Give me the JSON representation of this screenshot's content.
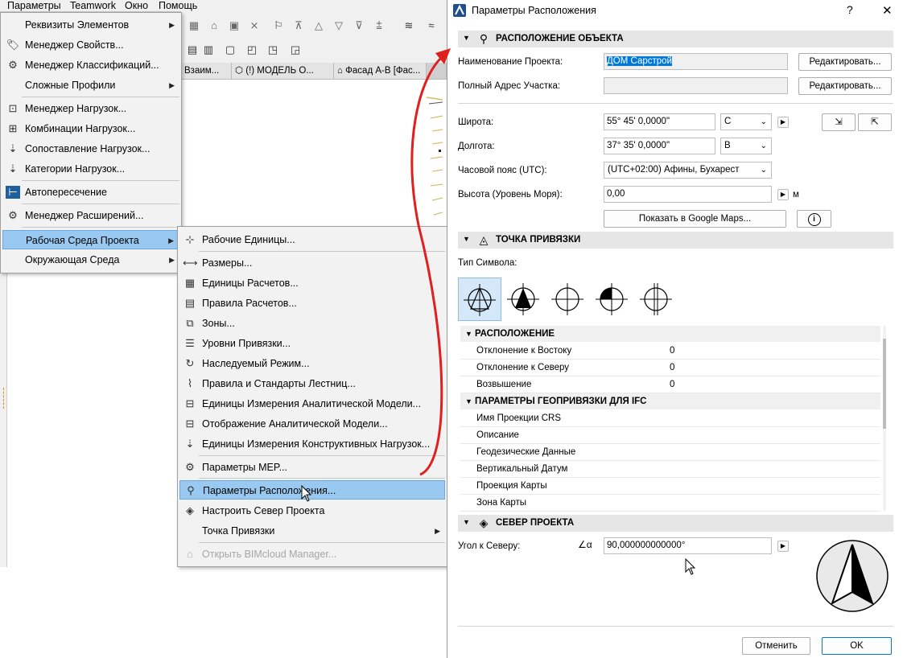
{
  "menubar": [
    "Параметры",
    "Teamwork",
    "Окно",
    "Помощь"
  ],
  "tabs": [
    "Взаим...",
    "(!) МОДЕЛЬ О...",
    "Фасад А-В [Фас...",
    ""
  ],
  "params_menu": {
    "items": [
      {
        "label": "Реквизиты Элементов",
        "icon": "attributes-icon",
        "submenu": true
      },
      {
        "label": "Менеджер Свойств...",
        "icon": "properties-manager-icon"
      },
      {
        "label": "Менеджер Классификаций...",
        "icon": "classification-manager-icon"
      },
      {
        "label": "Сложные Профили",
        "icon": "complex-profiles-icon",
        "submenu": true
      },
      {
        "label": "Менеджер Нагрузок...",
        "icon": "load-manager-icon"
      },
      {
        "label": "Комбинации Нагрузок...",
        "icon": "load-combinations-icon"
      },
      {
        "label": "Сопоставление Нагрузок...",
        "icon": "load-mapping-icon"
      },
      {
        "label": "Категории Нагрузок...",
        "icon": "load-categories-icon"
      },
      {
        "label": "Автопересечение",
        "icon": "auto-intersection-icon"
      },
      {
        "label": "Менеджер Расширений...",
        "icon": "add-on-manager-icon"
      },
      {
        "label": "Рабочая Среда Проекта",
        "icon": "",
        "submenu": true
      },
      {
        "label": "Окружающая Среда",
        "icon": "",
        "submenu": true
      }
    ]
  },
  "project_pref_menu": {
    "items": [
      {
        "label": "Рабочие Единицы...",
        "icon": "working-units-icon"
      },
      {
        "label": "Размеры...",
        "icon": "dimensions-icon"
      },
      {
        "label": "Единицы Расчетов...",
        "icon": "calculation-units-icon"
      },
      {
        "label": "Правила Расчетов...",
        "icon": "calculation-rules-icon"
      },
      {
        "label": "Зоны...",
        "icon": "zones-icon"
      },
      {
        "label": "Уровни Привязки...",
        "icon": "reference-levels-icon"
      },
      {
        "label": "Наследуемый Режим...",
        "icon": "legacy-mode-icon"
      },
      {
        "label": "Правила и Стандарты Лестниц...",
        "icon": "stair-rules-icon"
      },
      {
        "label": "Единицы Измерения Аналитической Модели...",
        "icon": "analytical-units-icon"
      },
      {
        "label": "Отображение Аналитической Модели...",
        "icon": "analytical-display-icon"
      },
      {
        "label": "Единицы Измерения Конструктивных Нагрузок...",
        "icon": "structural-load-units-icon"
      },
      {
        "label": "Параметры MEP...",
        "icon": "mep-icon"
      },
      {
        "label": "Параметры Расположения...",
        "icon": "location-icon"
      },
      {
        "label": "Настроить Север Проекта",
        "icon": "project-north-icon"
      },
      {
        "label": "Точка Привязки",
        "icon": "",
        "submenu": true
      },
      {
        "label": "Открыть BIMcloud Manager...",
        "icon": "bimcloud-icon"
      }
    ]
  },
  "dialog": {
    "title": "Параметры Расположения",
    "help": "?",
    "close": "✕",
    "location_section": {
      "title": "РАСПОЛОЖЕНИЕ ОБЪЕКТА",
      "project_name_label": "Наименование Проекта:",
      "project_name_value": "ДОМ Сарстрой",
      "full_address_label": "Полный Адрес Участка:",
      "full_address_value": "",
      "edit_button": "Редактировать...",
      "latitude_label": "Широта:",
      "latitude_value": "55° 45' 0,0000\"",
      "latitude_dir": "С",
      "longitude_label": "Долгота:",
      "longitude_value": "37° 35' 0,0000\"",
      "longitude_dir": "В",
      "timezone_label": "Часовой пояс (UTC):",
      "timezone_value": "(UTC+02:00) Афины, Бухарест",
      "elevation_label": "Высота (Уровень Моря):",
      "elevation_value": "0,00",
      "elevation_unit": "м",
      "google_maps_button": "Показать в Google Maps...",
      "info_button": "i"
    },
    "survey_section": {
      "title": "ТОЧКА ПРИВЯЗКИ",
      "symbol_type_label": "Тип Символа:",
      "placement_group": {
        "title": "РАСПОЛОЖЕНИЕ",
        "rows": [
          {
            "label": "Отклонение к Востоку",
            "value": "0"
          },
          {
            "label": "Отклонение к Северу",
            "value": "0"
          },
          {
            "label": "Возвышение",
            "value": "0"
          }
        ]
      },
      "ifc_group": {
        "title": "ПАРАМЕТРЫ ГЕОПРИВЯЗКИ ДЛЯ IFC",
        "rows": [
          {
            "label": "Имя Проекции CRS",
            "value": ""
          },
          {
            "label": "Описание",
            "value": ""
          },
          {
            "label": "Геодезические Данные",
            "value": ""
          },
          {
            "label": "Вертикальный Датум",
            "value": ""
          },
          {
            "label": "Проекция Карты",
            "value": ""
          },
          {
            "label": "Зона Карты",
            "value": ""
          }
        ]
      }
    },
    "north_section": {
      "title": "СЕВЕР ПРОЕКТА",
      "angle_label": "Угол к Северу:",
      "angle_symbol": "α",
      "angle_value": "90,000000000000°"
    },
    "cancel_button": "Отменить",
    "ok_button": "OK"
  },
  "colors": {
    "menu_highlight": "#99c8f0",
    "selection_blue": "#0078d7",
    "arrow_red": "#e0201f"
  }
}
